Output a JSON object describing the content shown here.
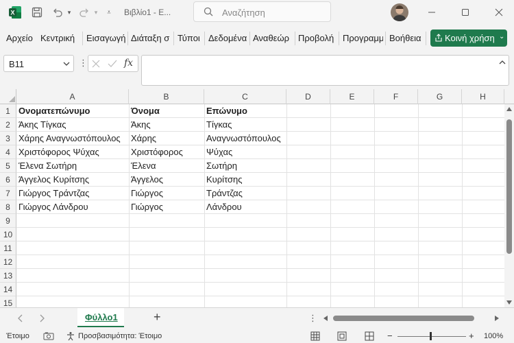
{
  "app": {
    "accent": "#1f7a4d"
  },
  "titlebar": {
    "doc_title": "Βιβλίο1 - Ε...",
    "search_placeholder": "Αναζήτηση",
    "icons": [
      "excel-logo",
      "save-icon",
      "undo-icon",
      "redo-icon",
      "customize-icon",
      "search-icon",
      "minimize-icon",
      "maximize-icon",
      "close-icon"
    ]
  },
  "ribbon": {
    "tabs": [
      "Αρχείο",
      "Κεντρική",
      "Εισαγωγή",
      "Διάταξη σ",
      "Τύποι",
      "Δεδομένα",
      "Αναθεώρ",
      "Προβολή",
      "Προγραμμ",
      "Βοήθεια"
    ],
    "share_label": "Κοινή χρήση"
  },
  "formula_bar": {
    "name_box": "B11",
    "fx_label": "fx",
    "content": ""
  },
  "grid": {
    "columns": [
      "A",
      "B",
      "C",
      "D",
      "E",
      "F",
      "G",
      "H"
    ],
    "row_numbers": [
      "1",
      "2",
      "3",
      "4",
      "5",
      "6",
      "7",
      "8",
      "9",
      "10",
      "11",
      "12",
      "13",
      "14",
      "15"
    ],
    "rows": [
      [
        "Ονοματεπώνυμο",
        "Όνομα",
        "Επώνυμο"
      ],
      [
        "Άκης Τίγκας",
        "Άκης",
        "Τίγκας"
      ],
      [
        "Χάρης  Αναγνωστόπουλος",
        "Χάρης",
        "Αναγνωστόπουλος"
      ],
      [
        "Χριστόφορος Ψύχας",
        "Χριστόφορος",
        "Ψύχας"
      ],
      [
        "Έλενα Σωτήρη",
        "Έλενα",
        "Σωτήρη"
      ],
      [
        "Άγγελος Κυρίτσης",
        "Άγγελος",
        "Κυρίτσης"
      ],
      [
        "Γιώργος Τράντζας",
        "Γιώργος",
        "Τράντζας"
      ],
      [
        "Γιώργος Λάνδρου",
        "Γιώργος",
        "Λάνδρου"
      ]
    ]
  },
  "sheets": {
    "tabs": [
      "Φύλλο1"
    ],
    "add_label": "+"
  },
  "status": {
    "ready": "Έτοιμο",
    "accessibility": "Προσβασιμότητα: Έτοιμο",
    "zoom": "100%",
    "zoom_minus": "−",
    "zoom_plus": "+"
  }
}
